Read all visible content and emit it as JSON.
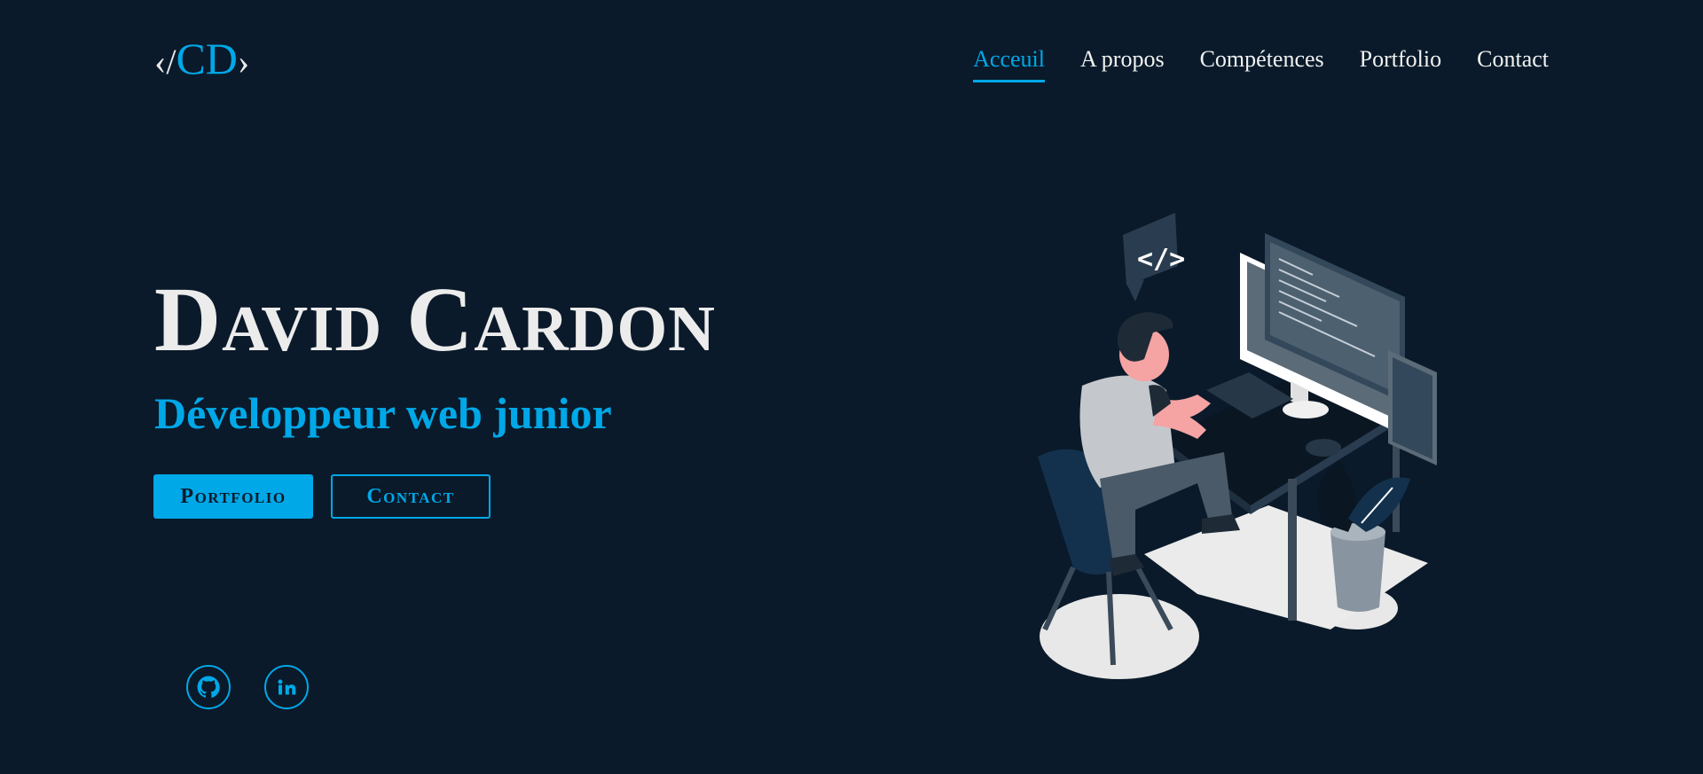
{
  "header": {
    "logo": {
      "open": "‹/",
      "letters": "CD",
      "close": "›"
    },
    "nav": [
      {
        "label": "Acceuil",
        "active": true
      },
      {
        "label": "A propos",
        "active": false
      },
      {
        "label": "Compétences",
        "active": false
      },
      {
        "label": "Portfolio",
        "active": false
      },
      {
        "label": "Contact",
        "active": false
      }
    ]
  },
  "hero": {
    "name": "David Cardon",
    "subtitle": "Développeur web junior",
    "buttons": {
      "primary": "Portfolio",
      "secondary": "Contact"
    }
  },
  "social": [
    {
      "icon": "github-icon"
    },
    {
      "icon": "linkedin-icon"
    }
  ],
  "illustration": {
    "code_badge": "</>"
  },
  "colors": {
    "background": "#0a1a2a",
    "accent": "#00a8e8",
    "text": "#ececec"
  }
}
